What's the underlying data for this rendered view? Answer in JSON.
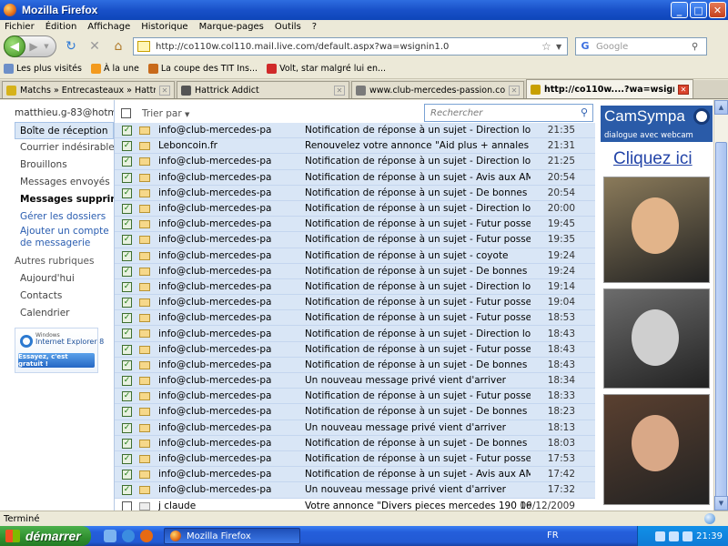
{
  "window": {
    "title": "Mozilla Firefox",
    "minimize": "_",
    "maximize": "□",
    "close": "✕"
  },
  "menu": [
    "Fichier",
    "Édition",
    "Affichage",
    "Historique",
    "Marque-pages",
    "Outils",
    "?"
  ],
  "nav": {
    "url": "http://co110w.col110.mail.live.com/default.aspx?wa=wsignin1.0",
    "search_placeholder": "Google"
  },
  "bookmarks": [
    {
      "label": "Les plus visités",
      "color": "#6d8fc8"
    },
    {
      "label": "À la une",
      "color": "#f39a1e"
    },
    {
      "label": "La coupe des TIT  Ins...",
      "color": "#c86a1a"
    },
    {
      "label": "Volt, star malgré lui en...",
      "color": "#d02a2a"
    }
  ],
  "tabs": [
    {
      "label": "Matchs » Entrecasteaux » Hattrick",
      "color": "#d6b21a"
    },
    {
      "label": "Hattrick Addict",
      "color": "#555555"
    },
    {
      "label": "www.club-mercedes-passion.com • Af...",
      "color": "#7a7a7a"
    },
    {
      "label": "http://co110w....?wa=wsignin1.0",
      "color": "#c8a000",
      "active": true
    }
  ],
  "sidebar": {
    "account": "matthieu.g-83@hotmail",
    "folders": [
      {
        "label": "Boîte de réception",
        "selected": true
      },
      {
        "label": "Courrier indésirable"
      },
      {
        "label": "Brouillons"
      },
      {
        "label": "Messages envoyés"
      },
      {
        "label": "Messages supprin",
        "bold": true
      }
    ],
    "manage": "Gérer les dossiers",
    "add_account": "Ajouter un compte de messagerie",
    "other_section": "Autres rubriques",
    "other": [
      "Aujourd'hui",
      "Contacts",
      "Calendrier"
    ],
    "ie8": {
      "windows": "Windows",
      "name": "Internet Explorer 8",
      "cta": "Essayez, c'est gratuit !"
    }
  },
  "mail": {
    "sort_label": "Trier par",
    "search_placeholder": "Rechercher",
    "rows": [
      {
        "from": "info@club-mercedes-pa",
        "subject": "Notification de réponse à un sujet - Direction lou",
        "time": "21:35",
        "checked": true,
        "unread": false
      },
      {
        "from": "Leboncoin.fr",
        "subject": "Renouvelez votre annonce \"Aid plus + annales p",
        "time": "21:31",
        "checked": true,
        "unread": false
      },
      {
        "from": "info@club-mercedes-pa",
        "subject": "Notification de réponse à un sujet - Direction lou",
        "time": "21:25",
        "checked": true,
        "unread": false
      },
      {
        "from": "info@club-mercedes-pa",
        "subject": "Notification de réponse à un sujet - Avis aux AMI",
        "time": "20:54",
        "checked": true,
        "unread": false
      },
      {
        "from": "info@club-mercedes-pa",
        "subject": "Notification de réponse à un sujet - De bonnes ac",
        "time": "20:54",
        "checked": true,
        "unread": false
      },
      {
        "from": "info@club-mercedes-pa",
        "subject": "Notification de réponse à un sujet - Direction lou",
        "time": "20:00",
        "checked": true,
        "unread": false
      },
      {
        "from": "info@club-mercedes-pa",
        "subject": "Notification de réponse à un sujet - Futur posses",
        "time": "19:45",
        "checked": true,
        "unread": false
      },
      {
        "from": "info@club-mercedes-pa",
        "subject": "Notification de réponse à un sujet - Futur posses",
        "time": "19:35",
        "checked": true,
        "unread": false
      },
      {
        "from": "info@club-mercedes-pa",
        "subject": "Notification de réponse à un sujet - coyote",
        "time": "19:24",
        "checked": true,
        "unread": false
      },
      {
        "from": "info@club-mercedes-pa",
        "subject": "Notification de réponse à un sujet - De bonnes ac",
        "time": "19:24",
        "checked": true,
        "unread": false
      },
      {
        "from": "info@club-mercedes-pa",
        "subject": "Notification de réponse à un sujet - Direction lou",
        "time": "19:14",
        "checked": true,
        "unread": false
      },
      {
        "from": "info@club-mercedes-pa",
        "subject": "Notification de réponse à un sujet - Futur posses",
        "time": "19:04",
        "checked": true,
        "unread": false
      },
      {
        "from": "info@club-mercedes-pa",
        "subject": "Notification de réponse à un sujet - Futur posses",
        "time": "18:53",
        "checked": true,
        "unread": false
      },
      {
        "from": "info@club-mercedes-pa",
        "subject": "Notification de réponse à un sujet - Direction lou",
        "time": "18:43",
        "checked": true,
        "unread": false
      },
      {
        "from": "info@club-mercedes-pa",
        "subject": "Notification de réponse à un sujet - Futur posses",
        "time": "18:43",
        "checked": true,
        "unread": false
      },
      {
        "from": "info@club-mercedes-pa",
        "subject": "Notification de réponse à un sujet - De bonnes ac",
        "time": "18:43",
        "checked": true,
        "unread": false
      },
      {
        "from": "info@club-mercedes-pa",
        "subject": "Un nouveau message privé vient d'arriver",
        "time": "18:34",
        "checked": true,
        "unread": false
      },
      {
        "from": "info@club-mercedes-pa",
        "subject": "Notification de réponse à un sujet - Futur posses",
        "time": "18:33",
        "checked": true,
        "unread": false
      },
      {
        "from": "info@club-mercedes-pa",
        "subject": "Notification de réponse à un sujet - De bonnes ac",
        "time": "18:23",
        "checked": true,
        "unread": false
      },
      {
        "from": "info@club-mercedes-pa",
        "subject": "Un nouveau message privé vient d'arriver",
        "time": "18:13",
        "checked": true,
        "unread": false
      },
      {
        "from": "info@club-mercedes-pa",
        "subject": "Notification de réponse à un sujet - De bonnes ac",
        "time": "18:03",
        "checked": true,
        "unread": false
      },
      {
        "from": "info@club-mercedes-pa",
        "subject": "Notification de réponse à un sujet - Futur posses",
        "time": "17:53",
        "checked": true,
        "unread": false
      },
      {
        "from": "info@club-mercedes-pa",
        "subject": "Notification de réponse à un sujet - Avis aux AMI",
        "time": "17:42",
        "checked": true,
        "unread": false
      },
      {
        "from": "info@club-mercedes-pa",
        "subject": "Un nouveau message privé vient d'arriver",
        "time": "17:32",
        "checked": true,
        "unread": false
      },
      {
        "from": "j claude",
        "subject": "Votre annonce \"Divers pieces mercedes 190 16s\" sur Le",
        "time": "09/12/2009",
        "checked": false,
        "unread": true
      }
    ]
  },
  "ad": {
    "brand": "CamSympa",
    "tagline": "dialogue avec webcam",
    "cta": "Cliquez ici",
    "photos": [
      {
        "bg": "#8a7a5a",
        "face": "#e2b48a"
      },
      {
        "bg": "#6c6c6c",
        "face": "#cfcfcf"
      },
      {
        "bg": "#5a4030",
        "face": "#d9a887"
      }
    ]
  },
  "status": "Terminé",
  "taskbar": {
    "start": "démarrer",
    "task": "Mozilla Firefox",
    "lang": "FR",
    "clock": "21:39"
  }
}
